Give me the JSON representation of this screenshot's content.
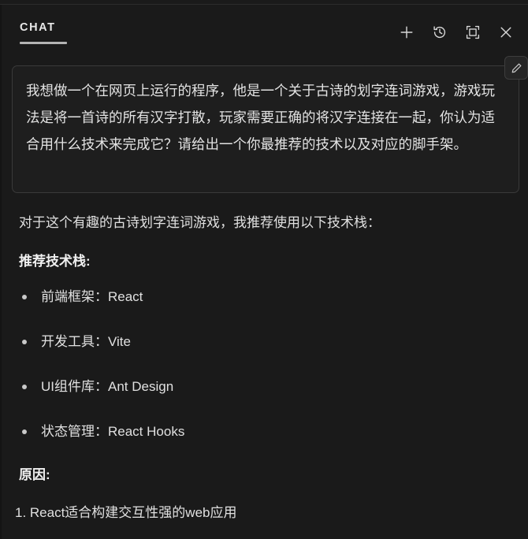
{
  "header": {
    "tab_label": "CHAT",
    "actions": [
      {
        "name": "new-chat-icon",
        "label": "+",
        "title": "New Chat"
      },
      {
        "name": "history-icon",
        "label": "",
        "title": "History"
      },
      {
        "name": "maximize-icon",
        "label": "",
        "title": "Maximize"
      },
      {
        "name": "close-icon",
        "label": "",
        "title": "Close"
      }
    ]
  },
  "user_message": {
    "text": "我想做一个在网页上运行的程序，他是一个关于古诗的划字连词游戏，游戏玩法是将一首诗的所有汉字打散，玩家需要正确的将汉字连接在一起，你认为适合用什么技术来完成它？请给出一个你最推荐的技术以及对应的脚手架。",
    "edit_button_label": "edit-pencil"
  },
  "assistant_reply": {
    "intro": "对于这个有趣的古诗划字连词游戏，我推荐使用以下技术栈：",
    "stack_heading": "推荐技术栈:",
    "stack_items": [
      "前端框架：React",
      "开发工具：Vite",
      "UI组件库：Ant Design",
      "状态管理：React Hooks"
    ],
    "reason_heading": "原因:",
    "reason_items": [
      "1. React适合构建交互性强的web应用"
    ]
  },
  "colors": {
    "background": "#1a1a1a",
    "panel": "#1e1e1e",
    "border": "#3a3a3a",
    "text": "#e0e0e0",
    "accent": "#b4b4b4"
  }
}
